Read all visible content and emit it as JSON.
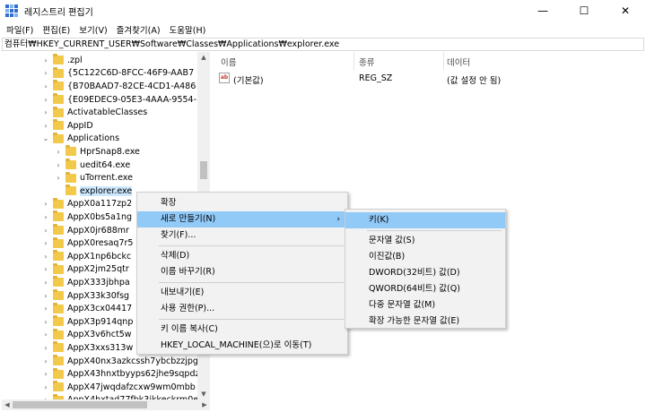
{
  "window": {
    "title": "레지스트리 편집기",
    "minimize": "—",
    "maximize": "☐",
    "close": "✕"
  },
  "menu": [
    "파일(F)",
    "편집(E)",
    "보기(V)",
    "즐겨찾기(A)",
    "도움말(H)"
  ],
  "address": "컴퓨터₩HKEY_CURRENT_USER₩Software₩Classes₩Applications₩explorer.exe",
  "tree": [
    {
      "label": ".zpl",
      "indent": 0,
      "arrow": "›"
    },
    {
      "label": "{5C122C6D-8FCC-46F9-AAB7",
      "indent": 0,
      "arrow": "›"
    },
    {
      "label": "{B70BAAD7-82CE-4CD1-A486",
      "indent": 0,
      "arrow": "›"
    },
    {
      "label": "{E09EDEC9-05E3-4AAA-9554-",
      "indent": 0,
      "arrow": "›"
    },
    {
      "label": "ActivatableClasses",
      "indent": 0,
      "arrow": "›"
    },
    {
      "label": "AppID",
      "indent": 0,
      "arrow": "›"
    },
    {
      "label": "Applications",
      "indent": 0,
      "arrow": "⌄"
    },
    {
      "label": "HprSnap8.exe",
      "indent": 1,
      "arrow": "›"
    },
    {
      "label": "uedit64.exe",
      "indent": 1,
      "arrow": "›"
    },
    {
      "label": "uTorrent.exe",
      "indent": 1,
      "arrow": "›"
    },
    {
      "label": "explorer.exe",
      "indent": 1,
      "arrow": "",
      "selected": true
    },
    {
      "label": "AppX0a117zp2",
      "indent": 0,
      "arrow": "›"
    },
    {
      "label": "AppX0bs5a1ng",
      "indent": 0,
      "arrow": "›"
    },
    {
      "label": "AppX0jr688mr",
      "indent": 0,
      "arrow": "›"
    },
    {
      "label": "AppX0resaq7r5",
      "indent": 0,
      "arrow": "›"
    },
    {
      "label": "AppX1np6bckc",
      "indent": 0,
      "arrow": "›"
    },
    {
      "label": "AppX2jm25qtr",
      "indent": 0,
      "arrow": "›"
    },
    {
      "label": "AppX333jbhpa",
      "indent": 0,
      "arrow": "›"
    },
    {
      "label": "AppX33k30fsg",
      "indent": 0,
      "arrow": "›"
    },
    {
      "label": "AppX3cx04417",
      "indent": 0,
      "arrow": "›"
    },
    {
      "label": "AppX3p914qnp",
      "indent": 0,
      "arrow": "›"
    },
    {
      "label": "AppX3v6hct5w",
      "indent": 0,
      "arrow": "›"
    },
    {
      "label": "AppX3xxs313w",
      "indent": 0,
      "arrow": "›"
    },
    {
      "label": "AppX40nx3azkcssh7ybcbzzjpg",
      "indent": 0,
      "arrow": "›"
    },
    {
      "label": "AppX43hnxtbyyps62jhe9sqpdz",
      "indent": 0,
      "arrow": "›"
    },
    {
      "label": "AppX47jwqdafzcxw9wm0mbb",
      "indent": 0,
      "arrow": "›"
    },
    {
      "label": "AppX4hxtad77fbk3ikkeckrm0e",
      "indent": 0,
      "arrow": "›"
    }
  ],
  "list": {
    "headers": {
      "name": "이름",
      "type": "종류",
      "data": "데이터"
    },
    "rows": [
      {
        "icon": "ab",
        "name": "(기본값)",
        "type": "REG_SZ",
        "data": "(값 설정 안 됨)"
      }
    ]
  },
  "context_menu": [
    {
      "label": "확장",
      "type": "item"
    },
    {
      "label": "새로 만들기(N)",
      "type": "item",
      "highlighted": true,
      "submenu": true
    },
    {
      "label": "찾기(F)...",
      "type": "item"
    },
    {
      "type": "sep"
    },
    {
      "label": "삭제(D)",
      "type": "item"
    },
    {
      "label": "이름 바꾸기(R)",
      "type": "item"
    },
    {
      "type": "sep"
    },
    {
      "label": "내보내기(E)",
      "type": "item"
    },
    {
      "label": "사용 권한(P)...",
      "type": "item"
    },
    {
      "type": "sep"
    },
    {
      "label": "키 이름 복사(C)",
      "type": "item"
    },
    {
      "label": "HKEY_LOCAL_MACHINE(으)로 이동(T)",
      "type": "item"
    }
  ],
  "submenu": [
    {
      "label": "키(K)",
      "type": "item",
      "highlighted": true
    },
    {
      "type": "sep"
    },
    {
      "label": "문자열 값(S)",
      "type": "item"
    },
    {
      "label": "이진값(B)",
      "type": "item"
    },
    {
      "label": "DWORD(32비트) 값(D)",
      "type": "item"
    },
    {
      "label": "QWORD(64비트) 값(Q)",
      "type": "item"
    },
    {
      "label": "다중 문자열 값(M)",
      "type": "item"
    },
    {
      "label": "확장 가능한 문자열 값(E)",
      "type": "item"
    }
  ],
  "colors": {
    "highlight": "#91c9f7",
    "selection": "#cce8ff",
    "folder": "#f3c94c"
  },
  "icons": {
    "app": "registry-editor-icon",
    "folder": "folder-icon",
    "value": "string-value-icon"
  }
}
